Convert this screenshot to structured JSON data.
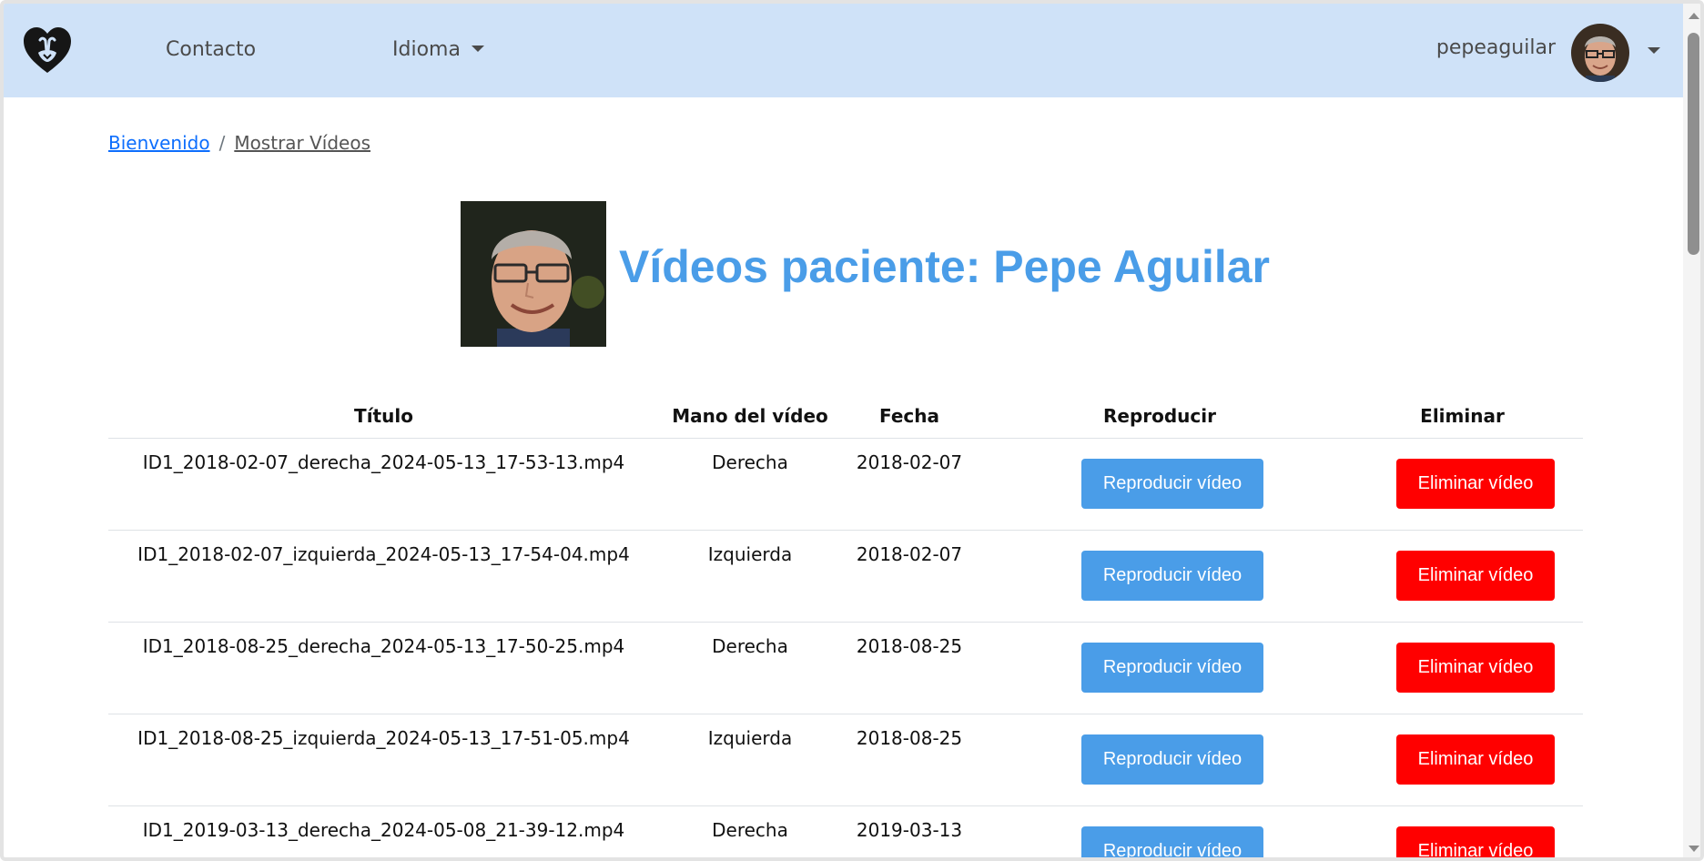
{
  "navbar": {
    "contact_label": "Contacto",
    "language_label": "Idioma",
    "username": "pepeaguilar"
  },
  "breadcrumb": {
    "home": "Bienvenido",
    "separator": "/",
    "current": "Mostrar Vídeos"
  },
  "page": {
    "title": "Vídeos paciente: Pepe Aguilar"
  },
  "table": {
    "headers": {
      "title": "Título",
      "hand": "Mano del vídeo",
      "date": "Fecha",
      "play": "Reproducir",
      "delete": "Eliminar"
    },
    "rows": [
      {
        "title": "ID1_2018-02-07_derecha_2024-05-13_17-53-13.mp4",
        "hand": "Derecha",
        "date": "2018-02-07",
        "play": "Reproducir vídeo",
        "delete": "Eliminar vídeo"
      },
      {
        "title": "ID1_2018-02-07_izquierda_2024-05-13_17-54-04.mp4",
        "hand": "Izquierda",
        "date": "2018-02-07",
        "play": "Reproducir vídeo",
        "delete": "Eliminar vídeo"
      },
      {
        "title": "ID1_2018-08-25_derecha_2024-05-13_17-50-25.mp4",
        "hand": "Derecha",
        "date": "2018-08-25",
        "play": "Reproducir vídeo",
        "delete": "Eliminar vídeo"
      },
      {
        "title": "ID1_2018-08-25_izquierda_2024-05-13_17-51-05.mp4",
        "hand": "Izquierda",
        "date": "2018-08-25",
        "play": "Reproducir vídeo",
        "delete": "Eliminar vídeo"
      },
      {
        "title": "ID1_2019-03-13_derecha_2024-05-08_21-39-12.mp4",
        "hand": "Derecha",
        "date": "2019-03-13",
        "play": "Reproducir vídeo",
        "delete": "Eliminar vídeo"
      }
    ]
  },
  "colors": {
    "navbar_bg": "#cfe2f8",
    "accent_blue": "#4a9de8",
    "danger_red": "#ff0000",
    "link_blue": "#0d6efd"
  },
  "icons": {
    "logo": "heart-hand-logo-icon",
    "dropdown": "caret-down-icon"
  }
}
